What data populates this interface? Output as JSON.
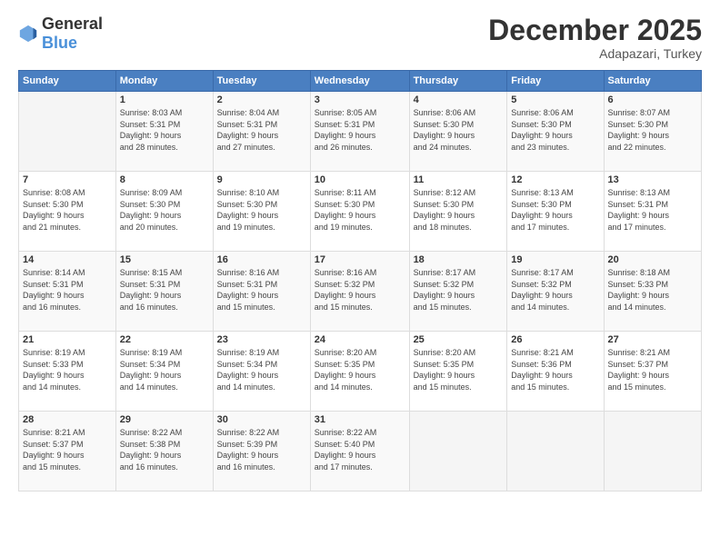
{
  "logo": {
    "general": "General",
    "blue": "Blue"
  },
  "header": {
    "month": "December 2025",
    "location": "Adapazari, Turkey"
  },
  "weekdays": [
    "Sunday",
    "Monday",
    "Tuesday",
    "Wednesday",
    "Thursday",
    "Friday",
    "Saturday"
  ],
  "weeks": [
    [
      {
        "day": "",
        "info": ""
      },
      {
        "day": "1",
        "info": "Sunrise: 8:03 AM\nSunset: 5:31 PM\nDaylight: 9 hours\nand 28 minutes."
      },
      {
        "day": "2",
        "info": "Sunrise: 8:04 AM\nSunset: 5:31 PM\nDaylight: 9 hours\nand 27 minutes."
      },
      {
        "day": "3",
        "info": "Sunrise: 8:05 AM\nSunset: 5:31 PM\nDaylight: 9 hours\nand 26 minutes."
      },
      {
        "day": "4",
        "info": "Sunrise: 8:06 AM\nSunset: 5:30 PM\nDaylight: 9 hours\nand 24 minutes."
      },
      {
        "day": "5",
        "info": "Sunrise: 8:06 AM\nSunset: 5:30 PM\nDaylight: 9 hours\nand 23 minutes."
      },
      {
        "day": "6",
        "info": "Sunrise: 8:07 AM\nSunset: 5:30 PM\nDaylight: 9 hours\nand 22 minutes."
      }
    ],
    [
      {
        "day": "7",
        "info": "Sunrise: 8:08 AM\nSunset: 5:30 PM\nDaylight: 9 hours\nand 21 minutes."
      },
      {
        "day": "8",
        "info": "Sunrise: 8:09 AM\nSunset: 5:30 PM\nDaylight: 9 hours\nand 20 minutes."
      },
      {
        "day": "9",
        "info": "Sunrise: 8:10 AM\nSunset: 5:30 PM\nDaylight: 9 hours\nand 19 minutes."
      },
      {
        "day": "10",
        "info": "Sunrise: 8:11 AM\nSunset: 5:30 PM\nDaylight: 9 hours\nand 19 minutes."
      },
      {
        "day": "11",
        "info": "Sunrise: 8:12 AM\nSunset: 5:30 PM\nDaylight: 9 hours\nand 18 minutes."
      },
      {
        "day": "12",
        "info": "Sunrise: 8:13 AM\nSunset: 5:30 PM\nDaylight: 9 hours\nand 17 minutes."
      },
      {
        "day": "13",
        "info": "Sunrise: 8:13 AM\nSunset: 5:31 PM\nDaylight: 9 hours\nand 17 minutes."
      }
    ],
    [
      {
        "day": "14",
        "info": "Sunrise: 8:14 AM\nSunset: 5:31 PM\nDaylight: 9 hours\nand 16 minutes."
      },
      {
        "day": "15",
        "info": "Sunrise: 8:15 AM\nSunset: 5:31 PM\nDaylight: 9 hours\nand 16 minutes."
      },
      {
        "day": "16",
        "info": "Sunrise: 8:16 AM\nSunset: 5:31 PM\nDaylight: 9 hours\nand 15 minutes."
      },
      {
        "day": "17",
        "info": "Sunrise: 8:16 AM\nSunset: 5:32 PM\nDaylight: 9 hours\nand 15 minutes."
      },
      {
        "day": "18",
        "info": "Sunrise: 8:17 AM\nSunset: 5:32 PM\nDaylight: 9 hours\nand 15 minutes."
      },
      {
        "day": "19",
        "info": "Sunrise: 8:17 AM\nSunset: 5:32 PM\nDaylight: 9 hours\nand 14 minutes."
      },
      {
        "day": "20",
        "info": "Sunrise: 8:18 AM\nSunset: 5:33 PM\nDaylight: 9 hours\nand 14 minutes."
      }
    ],
    [
      {
        "day": "21",
        "info": "Sunrise: 8:19 AM\nSunset: 5:33 PM\nDaylight: 9 hours\nand 14 minutes."
      },
      {
        "day": "22",
        "info": "Sunrise: 8:19 AM\nSunset: 5:34 PM\nDaylight: 9 hours\nand 14 minutes."
      },
      {
        "day": "23",
        "info": "Sunrise: 8:19 AM\nSunset: 5:34 PM\nDaylight: 9 hours\nand 14 minutes."
      },
      {
        "day": "24",
        "info": "Sunrise: 8:20 AM\nSunset: 5:35 PM\nDaylight: 9 hours\nand 14 minutes."
      },
      {
        "day": "25",
        "info": "Sunrise: 8:20 AM\nSunset: 5:35 PM\nDaylight: 9 hours\nand 15 minutes."
      },
      {
        "day": "26",
        "info": "Sunrise: 8:21 AM\nSunset: 5:36 PM\nDaylight: 9 hours\nand 15 minutes."
      },
      {
        "day": "27",
        "info": "Sunrise: 8:21 AM\nSunset: 5:37 PM\nDaylight: 9 hours\nand 15 minutes."
      }
    ],
    [
      {
        "day": "28",
        "info": "Sunrise: 8:21 AM\nSunset: 5:37 PM\nDaylight: 9 hours\nand 15 minutes."
      },
      {
        "day": "29",
        "info": "Sunrise: 8:22 AM\nSunset: 5:38 PM\nDaylight: 9 hours\nand 16 minutes."
      },
      {
        "day": "30",
        "info": "Sunrise: 8:22 AM\nSunset: 5:39 PM\nDaylight: 9 hours\nand 16 minutes."
      },
      {
        "day": "31",
        "info": "Sunrise: 8:22 AM\nSunset: 5:40 PM\nDaylight: 9 hours\nand 17 minutes."
      },
      {
        "day": "",
        "info": ""
      },
      {
        "day": "",
        "info": ""
      },
      {
        "day": "",
        "info": ""
      }
    ]
  ]
}
